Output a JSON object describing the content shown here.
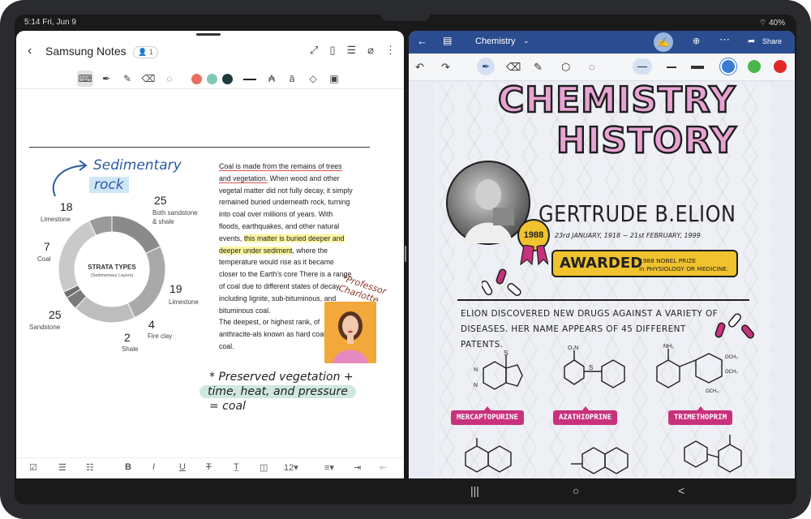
{
  "status": {
    "time_date": "5:14  Fri, Jun 9",
    "battery": "40%"
  },
  "left_app": {
    "title": "Samsung Notes",
    "collaborators": "1",
    "chart_data": {
      "type": "pie",
      "title": "STRATA TYPES",
      "subtitle": "(Sedimentary Layers)",
      "slices": [
        {
          "name": "Limestone",
          "value": 18
        },
        {
          "name": "Both sandstone & shale",
          "value": 25
        },
        {
          "name": "Limestone",
          "value": 19
        },
        {
          "name": "Fire clay",
          "value": 4
        },
        {
          "name": "Shale",
          "value": 2
        },
        {
          "name": "Sandstone",
          "value": 25
        },
        {
          "name": "Coal",
          "value": 7
        }
      ],
      "colors": [
        "#8a8a8a",
        "#a9a9a9",
        "#bdbdbd",
        "#7b7b7b",
        "#6f6f6f",
        "#c9c9c9",
        "#9a9a9a"
      ]
    },
    "labels": {
      "limestone_top": {
        "value": "18",
        "name": "Limestone"
      },
      "both": {
        "value": "25",
        "name1": "Both sandstone",
        "name2": "& shale"
      },
      "coal": {
        "value": "7",
        "name": "Coal"
      },
      "limestone_right": {
        "value": "19",
        "name": "Limestone"
      },
      "sandstone": {
        "value": "25",
        "name": "Sandstone"
      },
      "shale": {
        "value": "2",
        "name": "Shale"
      },
      "fireclay": {
        "value": "4",
        "name": "Fire clay"
      }
    },
    "handwriting": {
      "title": "Sedimentary",
      "subtitle": "rock",
      "professor": "*Professor Charlotte",
      "note1": "* Preserved vegetation +",
      "note2": "time, heat, and pressure",
      "note3": "= coal"
    },
    "body": {
      "p1_a": "Coal is made from the remains of trees and vegetation.",
      "p1_b": " When wood and other vegetal matter did not fully decay, it simply remained buried underneath rock, turning into coal over millions of years. With floods, earthquakes, and other natural events, ",
      "p1_c": "this matter is buried deeper and deeper under sediment",
      "p1_d": ", where the temperature would rise as it became closer to the Earth's core There is a range of coal due to different states of decay, including lignite, sub-bituminous, and bituminous coal.",
      "p2": "The deepest, or highest rank, of anthracite-als known as hard coal or black coal."
    },
    "format": {
      "font_size": "12"
    }
  },
  "right_app": {
    "title": "Chemistry",
    "share": "Share",
    "page": {
      "title1": "CHEMISTRY",
      "title2": "HISTORY",
      "name": "GERTRUDE B.ELION",
      "dates": "23rd JANUARY, 1918 ~ 21st FEBRUARY, 1999",
      "seal": "1988",
      "awarded": "AWARDED",
      "awarded_detail1": "1988 NOBEL PRIZE",
      "awarded_detail2": "in PHYSIOLOGY OR MEDICINE.",
      "desc": "ELION DISCOVERED NEW DRUGS AGAINST A VARIETY OF DISEASES. HER NAME APPEARS OF 45 DIFFERENT PATENTS.",
      "mol1": "MERCAPTOPURINE",
      "mol2": "AZATHIOPRINE",
      "mol3": "TRIMETHOPRIM"
    },
    "colors": {
      "appbar": "#2b4d8f",
      "accent_pink": "#c8327c",
      "gold": "#f0c22e"
    }
  },
  "nav": {
    "recents": "|||",
    "home": "○",
    "back": "<"
  }
}
